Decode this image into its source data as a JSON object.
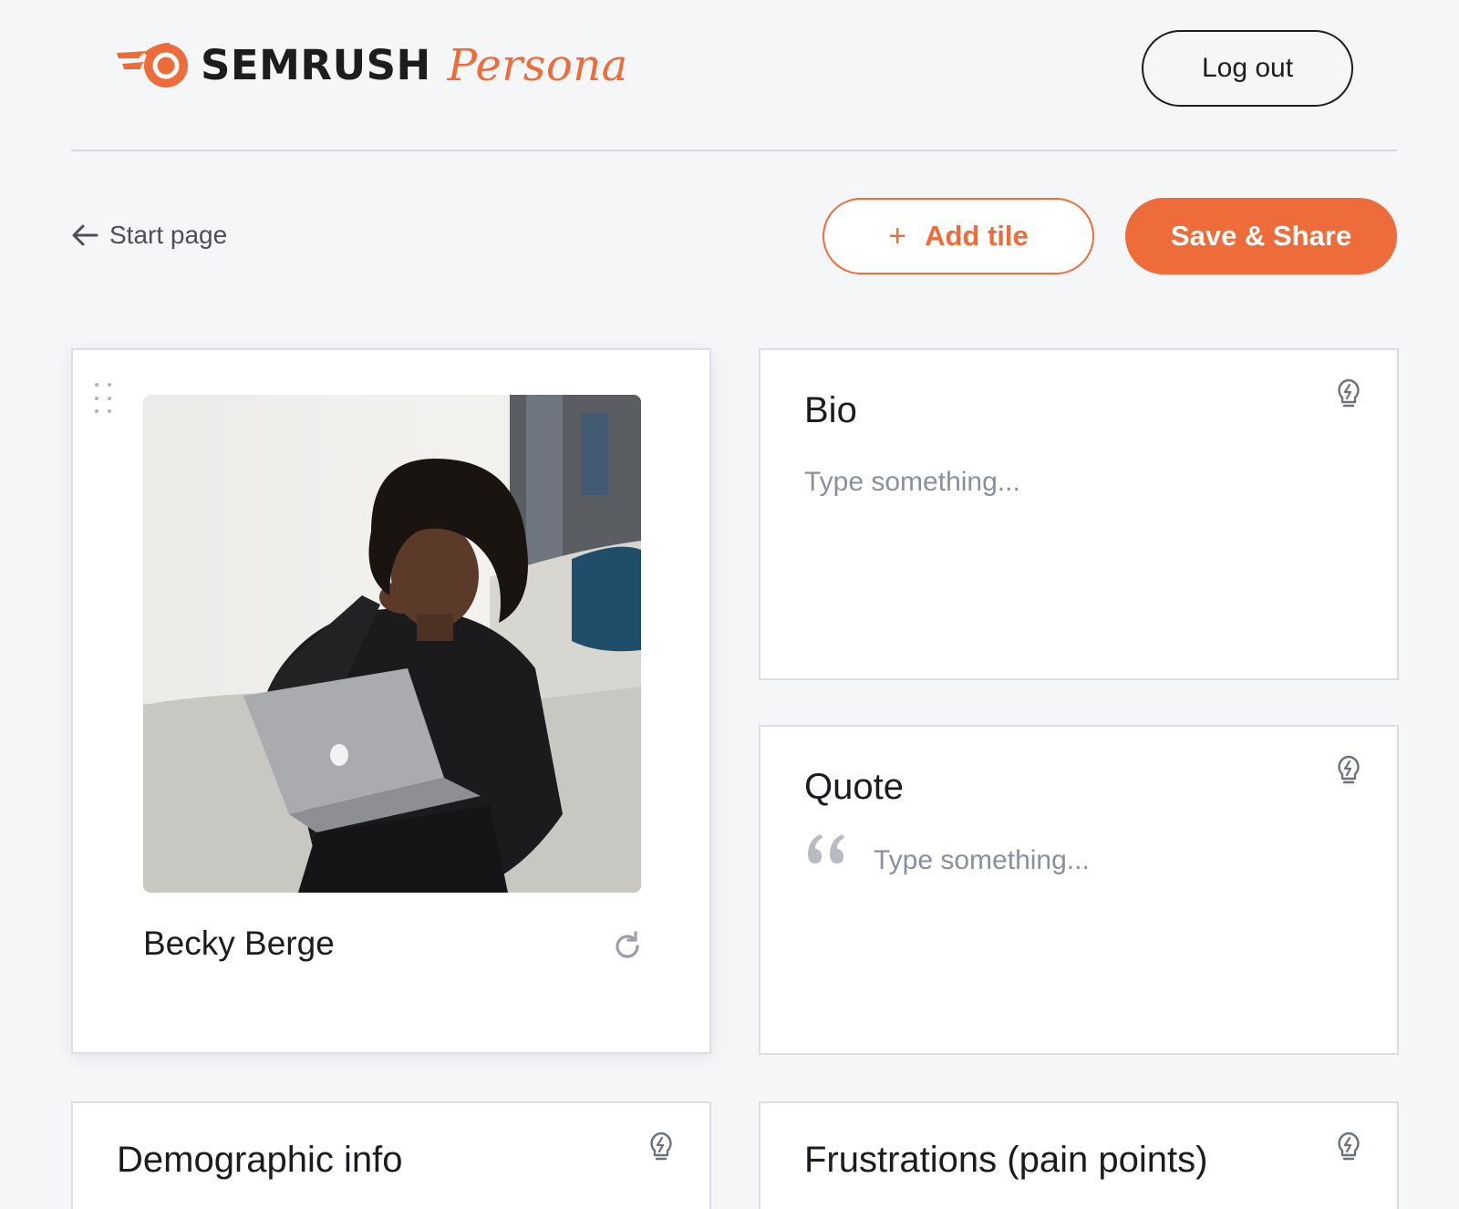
{
  "header": {
    "brand": "SEMRUSH",
    "product": "Persona",
    "logout_label": "Log out"
  },
  "toolbar": {
    "back_label": "Start page",
    "add_tile_label": "Add tile",
    "save_share_label": "Save & Share"
  },
  "profile": {
    "name": "Becky Berge"
  },
  "tiles": {
    "bio": {
      "title": "Bio",
      "placeholder": "Type something..."
    },
    "quote": {
      "title": "Quote",
      "placeholder": "Type something..."
    },
    "demographic": {
      "title": "Demographic info"
    },
    "frustrations": {
      "title": "Frustrations (pain points)"
    }
  },
  "colors": {
    "accent": "#ee6c3a",
    "background": "#f5f6f8",
    "text": "#1c1c20",
    "muted": "#8a8f99"
  },
  "icons": {
    "back": "arrow-left-icon",
    "add": "plus-icon",
    "drag": "drag-handle-icon",
    "refresh": "refresh-icon",
    "tip": "lightbulb-icon",
    "quote": "quote-mark-icon"
  }
}
